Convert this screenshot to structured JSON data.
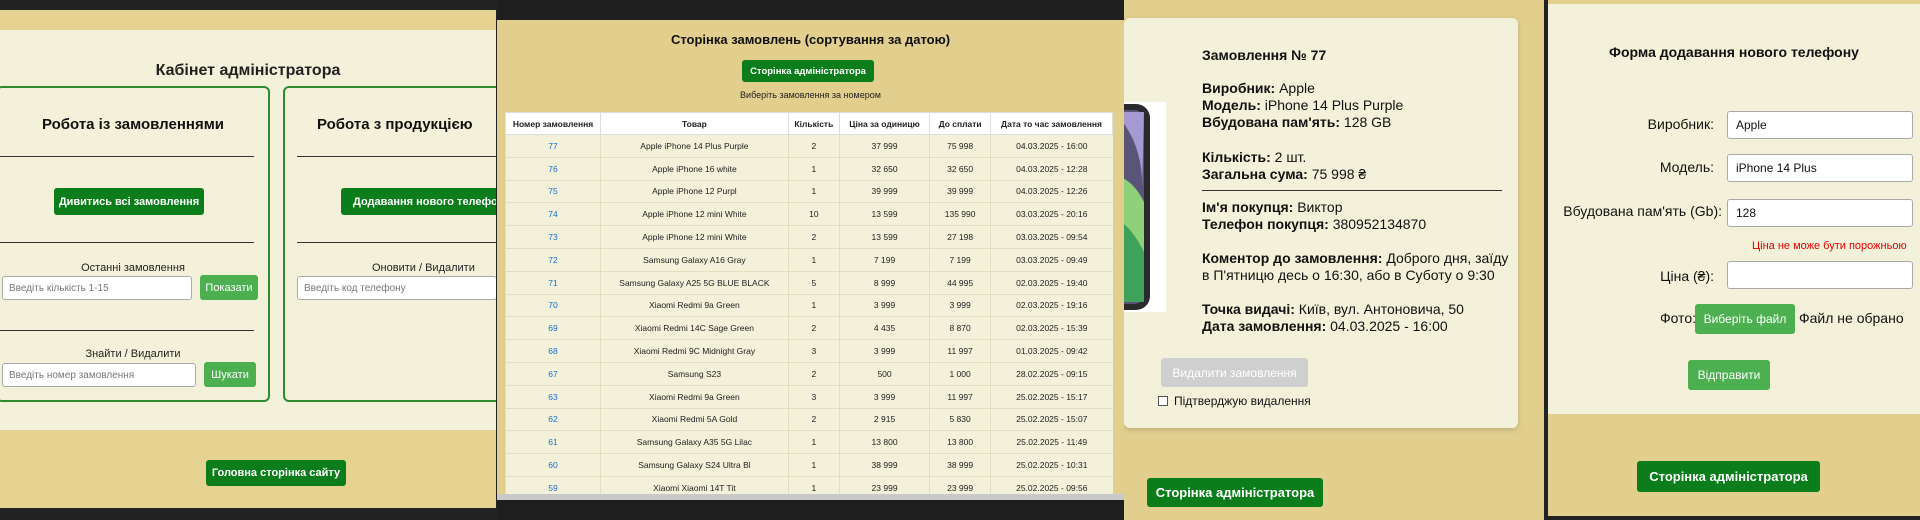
{
  "panel1": {
    "title": "Кабінет адміністратора",
    "orders_box": {
      "title": "Робота із замовленнями",
      "view_all_button": "Дивитись всі замовлення",
      "recent_label": "Останні замовлення",
      "recent_placeholder": "Введіть кількість 1-15",
      "show_button": "Показати",
      "find_label": "Знайти / Видалити",
      "find_placeholder": "Введіть номер замовлення",
      "search_button": "Шукати"
    },
    "products_box": {
      "title": "Робота з продукцією",
      "add_phone_button": "Додавання нового телефону",
      "update_label": "Оновити / Видалити",
      "code_placeholder": "Введіть код телефону"
    },
    "home_button": "Головна сторінка сайту"
  },
  "panel2": {
    "title": "Сторінка замовлень (сортування за датою)",
    "admin_button": "Сторінка адміністратора",
    "subtitle": "Виберіть замовлення за номером",
    "columns": [
      "Номер замовлення",
      "Товар",
      "Кількість",
      "Ціна за одиницю",
      "До сплати",
      "Дата то час замовлення"
    ],
    "rows": [
      [
        "77",
        "Apple iPhone 14 Plus Purple",
        "2",
        "37 999",
        "75 998",
        "04.03.2025 - 16:00"
      ],
      [
        "76",
        "Apple iPhone 16 white",
        "1",
        "32 650",
        "32 650",
        "04.03.2025 - 12:28"
      ],
      [
        "75",
        "Apple iPhone 12 Purpl",
        "1",
        "39 999",
        "39 999",
        "04.03.2025 - 12:26"
      ],
      [
        "74",
        "Apple iPhone 12 mini White",
        "10",
        "13 599",
        "135 990",
        "03.03.2025 - 20:16"
      ],
      [
        "73",
        "Apple iPhone 12 mini White",
        "2",
        "13 599",
        "27 198",
        "03.03.2025 - 09:54"
      ],
      [
        "72",
        "Samsung Galaxy A16 Gray",
        "1",
        "7 199",
        "7 199",
        "03.03.2025 - 09:49"
      ],
      [
        "71",
        "Samsung Galaxy A25 5G BLUE BLACK",
        "5",
        "8 999",
        "44 995",
        "02.03.2025 - 19:40"
      ],
      [
        "70",
        "Xiaomi Redmi 9a Green",
        "1",
        "3 999",
        "3 999",
        "02.03.2025 - 19:16"
      ],
      [
        "69",
        "Xiaomi Redmi 14C Sage Green",
        "2",
        "4 435",
        "8 870",
        "02.03.2025 - 15:39"
      ],
      [
        "68",
        "Xiaomi Redmi 9C Midnight Gray",
        "3",
        "3 999",
        "11 997",
        "01.03.2025 - 09:42"
      ],
      [
        "67",
        "Samsung S23",
        "2",
        "500",
        "1 000",
        "28.02.2025 - 09:15"
      ],
      [
        "63",
        "Xiaomi Redmi 9a Green",
        "3",
        "3 999",
        "11 997",
        "25.02.2025 - 15:17"
      ],
      [
        "62",
        "Xiaomi Redmi 5A Gold",
        "2",
        "2 915",
        "5 830",
        "25.02.2025 - 15:07"
      ],
      [
        "61",
        "Samsung Galaxy A35 5G Lilac",
        "1",
        "13 800",
        "13 800",
        "25.02.2025 - 11:49"
      ],
      [
        "60",
        "Samsung Galaxy S24 Ultra Bl",
        "1",
        "38 999",
        "38 999",
        "25.02.2025 - 10:31"
      ],
      [
        "59",
        "Xiaomi Xiaomi 14T Tit",
        "1",
        "23 999",
        "23 999",
        "25.02.2025 - 09:56"
      ]
    ]
  },
  "panel3": {
    "order_title": "Замовлення № 77",
    "maker_label": "Виробник:",
    "maker_value": "Apple",
    "model_label": "Модель:",
    "model_value": "iPhone 14 Plus Purple",
    "memory_label": "Вбудована пам'ять:",
    "memory_value": "128 GB",
    "qty_label": "Кількість:",
    "qty_value": "2 шт.",
    "total_label": "Загальна сума:",
    "total_value": "75 998 ₴",
    "buyer_label": "Ім'я покупця:",
    "buyer_value": "Виктор",
    "phone_label": "Телефон покупця:",
    "phone_value": "380952134870",
    "comment_label": "Коментор до замовлення:",
    "comment_value_1": "Доброго дня, заїду",
    "comment_value_2": "в П'ятницю десь о 16:30, або в Суботу о 9:30",
    "pickup_label": "Точка видачі:",
    "pickup_value": "Київ, вул. Антоновича, 50",
    "date_label": "Дата замовлення:",
    "date_value": "04.03.2025 - 16:00",
    "delete_button": "Видалити замовлення",
    "confirm_label": "Підтверджую видалення",
    "admin_button": "Сторінка адміністратора"
  },
  "panel4": {
    "title": "Форма додавання нового телефону",
    "maker_label": "Виробник:",
    "maker_value": "Apple",
    "model_label": "Модель:",
    "model_value": "iPhone 14 Plus",
    "memory_label": "Вбудована пам'ять (Gb):",
    "memory_value": "128",
    "error_text": "Ціна не може бути порожньою",
    "price_label": "Ціна (₴):",
    "price_value": "",
    "photo_label": "Фото:",
    "choose_file_button": "Виберіть файл",
    "no_file_text": "Файл не обрано",
    "submit_button": "Відправити",
    "admin_button": "Сторінка адміністратора"
  }
}
